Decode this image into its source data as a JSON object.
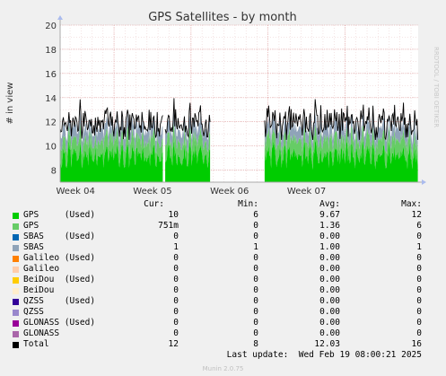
{
  "chart_data": {
    "type": "area",
    "title": "GPS Satellites - by month",
    "ylabel": "# in view",
    "ylim": [
      7,
      20
    ],
    "yticks": [
      8,
      10,
      12,
      14,
      16,
      18,
      20
    ],
    "xticks": [
      "Week 04",
      "Week 05",
      "Week 06",
      "Week 07"
    ],
    "x_range_weeks": [
      3.3,
      7.95
    ],
    "gaps": [
      [
        4.64,
        4.66
      ],
      [
        5.25,
        5.95
      ]
    ],
    "grid": true,
    "series": [
      {
        "name": "GPS (Used)",
        "color": "#00cc00",
        "typical_range": [
          8,
          10.5
        ]
      },
      {
        "name": "GPS",
        "color": "#66cc66",
        "typical_range": [
          1,
          1.5
        ]
      },
      {
        "name": "SBAS",
        "color": "#8fa3b8",
        "typical_range": [
          1,
          1
        ]
      },
      {
        "name": "Total",
        "color": "#000000",
        "typical_range": [
          10.5,
          14.6
        ]
      }
    ]
  },
  "side_label": "RRDTOOL / TOBI OETIKER",
  "legend": {
    "headers": {
      "cur": "Cur:",
      "min": "Min:",
      "avg": "Avg:",
      "max": "Max:"
    },
    "rows": [
      {
        "label": "GPS     (Used)",
        "color": "#00cc00",
        "cur": "10",
        "min": "6",
        "avg": "9.67",
        "max": "12"
      },
      {
        "label": "GPS",
        "color": "#66cc66",
        "cur": "751m",
        "min": "0",
        "avg": "1.36",
        "max": "6"
      },
      {
        "label": "SBAS    (Used)",
        "color": "#0066b3",
        "cur": "0",
        "min": "0",
        "avg": "0.00",
        "max": "0"
      },
      {
        "label": "SBAS",
        "color": "#8fa3b8",
        "cur": "1",
        "min": "1",
        "avg": "1.00",
        "max": "1"
      },
      {
        "label": "Galileo (Used)",
        "color": "#ff8000",
        "cur": "0",
        "min": "0",
        "avg": "0.00",
        "max": "0"
      },
      {
        "label": "Galileo",
        "color": "#ffccaa",
        "cur": "0",
        "min": "0",
        "avg": "0.00",
        "max": "0"
      },
      {
        "label": "BeiDou  (Used)",
        "color": "#ffcc00",
        "cur": "0",
        "min": "0",
        "avg": "0.00",
        "max": "0"
      },
      {
        "label": "BeiDou",
        "color": "#ffeecc",
        "cur": "0",
        "min": "0",
        "avg": "0.00",
        "max": "0"
      },
      {
        "label": "QZSS    (Used)",
        "color": "#330099",
        "cur": "0",
        "min": "0",
        "avg": "0.00",
        "max": "0"
      },
      {
        "label": "QZSS",
        "color": "#9988cc",
        "cur": "0",
        "min": "0",
        "avg": "0.00",
        "max": "0"
      },
      {
        "label": "GLONASS (Used)",
        "color": "#990099",
        "cur": "0",
        "min": "0",
        "avg": "0.00",
        "max": "0"
      },
      {
        "label": "GLONASS",
        "color": "#aa66aa",
        "cur": "0",
        "min": "0",
        "avg": "0.00",
        "max": "0"
      },
      {
        "label": "Total",
        "color": "#000000",
        "cur": "12",
        "min": "8",
        "avg": "12.03",
        "max": "16"
      }
    ]
  },
  "last_update": "Last update:  Wed Feb 19 08:00:21 2025",
  "footer": "Munin 2.0.75"
}
